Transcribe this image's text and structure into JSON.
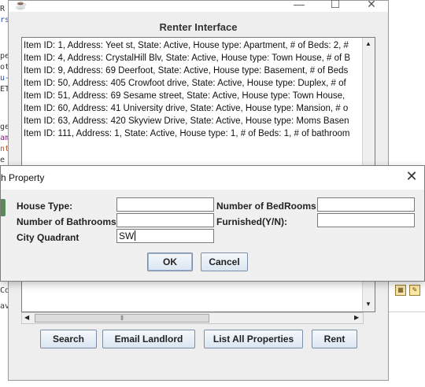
{
  "background": {
    "code_fragments": [
      "R",
      "rs",
      "pe",
      "ot",
      "u-",
      "ET",
      "ge",
      "am",
      "nt",
      "e",
      "Co",
      "av"
    ]
  },
  "renter_window": {
    "title": "Renter Interface",
    "window_controls": [
      "minimize-icon",
      "maximize-icon",
      "close-icon"
    ],
    "list_items": [
      "Item ID: 1, Address: Yeet st, State: Active, House type: Apartment, # of Beds: 2, #",
      "Item ID: 4, Address: CrystalHill Blv, State: Active, House type: Town House, # of B",
      "Item ID: 9, Address: 69 Deerfoot, State: Active, House type: Basement, # of Beds",
      "Item ID: 50, Address: 405 Crowfoot drive, State: Active, House type: Duplex, # of",
      "Item ID: 51, Address: 69 Sesame street, State: Active, House type: Town House,",
      "Item ID: 60, Address: 41 University drive, State: Active, House type: Mansion, # o",
      "Item ID: 63, Address: 420 Skyview Drive, State: Active, House type: Moms Basen",
      "Item ID: 111, Address: 1, State: Active, House type: 1, # of Beds: 1, # of bathroom"
    ],
    "buttons": {
      "search": "Search",
      "email_landlord": "Email Landlord",
      "list_all": "List All Properties",
      "rent": "Rent"
    }
  },
  "search_dialog": {
    "title": "h Property",
    "labels": {
      "house_type": "House Type:",
      "bedrooms": "Number of BedRooms",
      "bathrooms": "Number of Bathrooms",
      "furnished": "Furnished(Y/N):",
      "quadrant": "City Quadrant"
    },
    "values": {
      "house_type": "",
      "bedrooms": "",
      "bathrooms": "",
      "furnished": "",
      "quadrant": "SW"
    },
    "ok": "OK",
    "cancel": "Cancel"
  }
}
